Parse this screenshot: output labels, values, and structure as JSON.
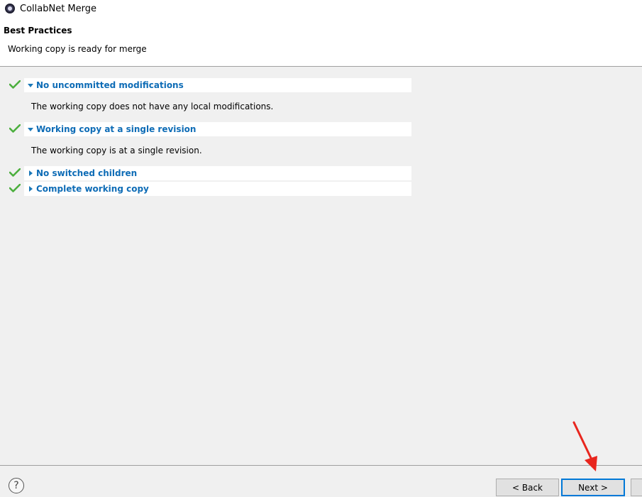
{
  "window": {
    "title": "CollabNet Merge",
    "icon": "collabnet-app-icon"
  },
  "header": {
    "title": "Best Practices",
    "description": "Working copy is ready for merge"
  },
  "checks": [
    {
      "label": "No uncommitted modifications",
      "expanded": true,
      "status": "passed",
      "description": "The working copy does not have any local modifications."
    },
    {
      "label": "Working copy at a single revision",
      "expanded": true,
      "status": "passed",
      "description": "The working copy is at a single revision."
    },
    {
      "label": "No switched children",
      "expanded": false,
      "status": "passed"
    },
    {
      "label": "Complete working copy",
      "expanded": false,
      "status": "passed"
    }
  ],
  "footer": {
    "help_symbol": "?",
    "back_label": "< Back",
    "next_label": "Next >"
  },
  "colors": {
    "link_blue": "#0e6cb6",
    "check_green": "#4caf3e",
    "focus_blue": "#0078d7",
    "annotation_red": "#e8261e"
  }
}
